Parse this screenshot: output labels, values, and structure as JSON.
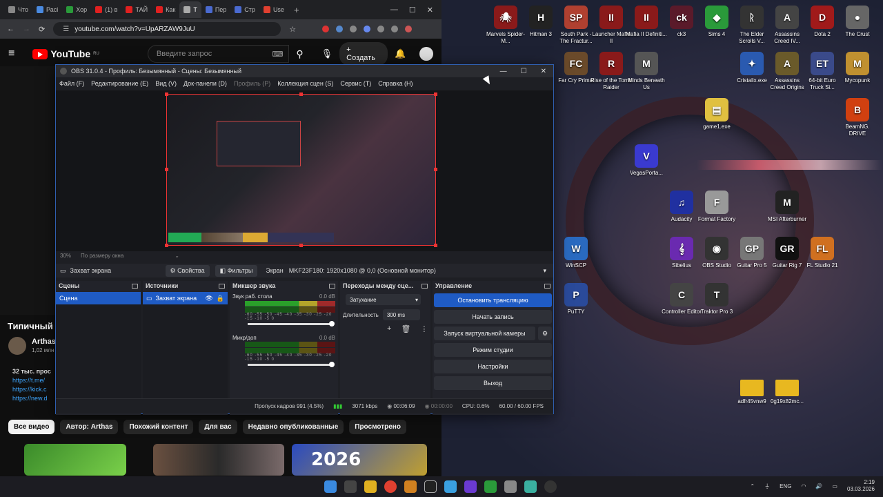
{
  "browser": {
    "tabs": [
      "Что",
      "Расі",
      "Хор",
      "(1) в",
      "ТАЙ",
      "Как",
      "Т",
      "Пер",
      "Стр",
      "Use"
    ],
    "url": "youtube.com/watch?v=UpARZAW9JuU",
    "youtube": {
      "logo": "YouTube",
      "region": "RU",
      "search_placeholder": "Введите запрос",
      "create_label": "Создать",
      "video_title": "Типичный",
      "channel_name": "Arthas",
      "subscribers": "1,02 млн",
      "description_views": "32 тыс. прос",
      "links": [
        "https://t.me/",
        "https://kick.c",
        "https://new.d"
      ],
      "chips": [
        "Все видео",
        "Автор: Arthas",
        "Похожий контент",
        "Для вас",
        "Недавно опубликованные",
        "Просмотрено"
      ],
      "thumb_label": "2026"
    }
  },
  "obs": {
    "title": "OBS 31.0.4 - Профиль: Безымянный - Сцены: Безымянный",
    "menu": [
      "Файл (F)",
      "Редактирование (E)",
      "Вид (V)",
      "Док-панели (D)",
      "Профиль (P)",
      "Коллекция сцен (S)",
      "Сервис (T)",
      "Справка (H)"
    ],
    "zoom": "30%",
    "zoom_mode": "По размеру окна",
    "source_toolbar": {
      "source_name": "Захват экрана",
      "properties": "Свойства",
      "filters": "Фильтры",
      "screen_label": "Экран",
      "screen_value": "MKF23F180: 1920x1080 @ 0,0 (Основной монитор)"
    },
    "docks": {
      "scenes": {
        "title": "Сцены",
        "items": [
          "Сцена"
        ]
      },
      "sources": {
        "title": "Источники",
        "items": [
          "Захват экрана"
        ]
      },
      "mixer": {
        "title": "Микшер звука",
        "channels": [
          {
            "name": "Звук раб. стола",
            "db": "0.0 dB"
          },
          {
            "name": "Микр/доп",
            "db": "0.0 dB"
          }
        ],
        "scale": "-60 -55 -50 -45 -40 -35 -30 -25 -20 -15 -10 -5 0"
      },
      "transitions": {
        "title": "Переходы между сце...",
        "type": "Затухание",
        "duration_label": "Длительность",
        "duration_value": "300 ms"
      },
      "controls": {
        "title": "Управление",
        "buttons": [
          "Остановить трансляцию",
          "Начать запись",
          "Запуск виртуальной камеры",
          "Режим студии",
          "Настройки",
          "Выход"
        ]
      }
    },
    "status": {
      "dropped": "Пропуск кадров 991 (4.5%)",
      "bitrate": "3071 kbps",
      "stream_time": "00:06:09",
      "rec_time": "00:00:00",
      "cpu": "CPU: 0.6%",
      "fps": "60.00 / 60.00 FPS"
    }
  },
  "desktop": {
    "icons": [
      {
        "label": "Marvels Spider-M...",
        "color": "#8a1a1a",
        "glyph": "🕷"
      },
      {
        "label": "Hitman 3",
        "color": "#222",
        "glyph": "H"
      },
      {
        "label": "South Park - The Fractur...",
        "color": "#b04030",
        "glyph": "SP"
      },
      {
        "label": "Launcher Mafia II",
        "color": "#8a1a1a",
        "glyph": "II"
      },
      {
        "label": "Mafia II Definiti...",
        "color": "#8a1a1a",
        "glyph": "II"
      },
      {
        "label": "ck3",
        "color": "#5a1a2a",
        "glyph": "ck"
      },
      {
        "label": "Sims 4",
        "color": "#2a9a3a",
        "glyph": "◆"
      },
      {
        "label": "The Elder Scrolls V...",
        "color": "#333",
        "glyph": "ᚱ"
      },
      {
        "label": "Assassins Creed IV...",
        "color": "#444",
        "glyph": "A"
      },
      {
        "label": "Dota 2",
        "color": "#a01a1a",
        "glyph": "D"
      },
      {
        "label": "The Crust",
        "color": "#666",
        "glyph": "●"
      },
      {
        "label": "Far Cry Primal",
        "color": "#6a4a2a",
        "glyph": "FC"
      },
      {
        "label": "Rise of the Tomb Raider",
        "color": "#8a1a1a",
        "glyph": "R"
      },
      {
        "label": "Minds Beneath Us",
        "color": "#555",
        "glyph": "M"
      },
      {
        "label": "Cristalix.exe",
        "color": "#2a5ab0",
        "glyph": "✦"
      },
      {
        "label": "Assassins Creed Origins",
        "color": "#6a5a2a",
        "glyph": "A"
      },
      {
        "label": "64-bit Euro Truck Si...",
        "color": "#3a4a8a",
        "glyph": "ET"
      },
      {
        "label": "Mycopunk",
        "color": "#c09030",
        "glyph": "M"
      },
      {
        "label": "BeamNG. DRIVE",
        "color": "#d04010",
        "glyph": "B"
      },
      {
        "label": "game1.exe",
        "color": "#e0c040",
        "glyph": "▤"
      },
      {
        "label": "VegasPorta...",
        "color": "#3a3ad0",
        "glyph": "V"
      },
      {
        "label": "Audacity",
        "color": "#2030a0",
        "glyph": "♫"
      },
      {
        "label": "Format Factory",
        "color": "#999",
        "glyph": "F"
      },
      {
        "label": "MSI Afterburner",
        "color": "#222",
        "glyph": "M"
      },
      {
        "label": "WinSCP",
        "color": "#2a6ac0",
        "glyph": "W"
      },
      {
        "label": "Sibelius",
        "color": "#6a2ab0",
        "glyph": "𝄞"
      },
      {
        "label": "OBS Studio",
        "color": "#333",
        "glyph": "◉"
      },
      {
        "label": "Guitar Pro 5",
        "color": "#777",
        "glyph": "GP"
      },
      {
        "label": "Guitar Rig 7",
        "color": "#111",
        "glyph": "GR"
      },
      {
        "label": "FL Studio 21",
        "color": "#d07020",
        "glyph": "FL"
      },
      {
        "label": "PuTTY",
        "color": "#2a4a9a",
        "glyph": "P"
      },
      {
        "label": "Controller Editor",
        "color": "#444",
        "glyph": "C"
      },
      {
        "label": "Traktor Pro 3",
        "color": "#333",
        "glyph": "T"
      },
      {
        "label": "adfr45vnw9",
        "color": "#e8b820",
        "glyph": ""
      },
      {
        "label": "0g19x82mc...",
        "color": "#e8b820",
        "glyph": ""
      }
    ]
  },
  "taskbar": {
    "lang": "ENG",
    "time": "2:19",
    "date": "03.03.2026"
  }
}
